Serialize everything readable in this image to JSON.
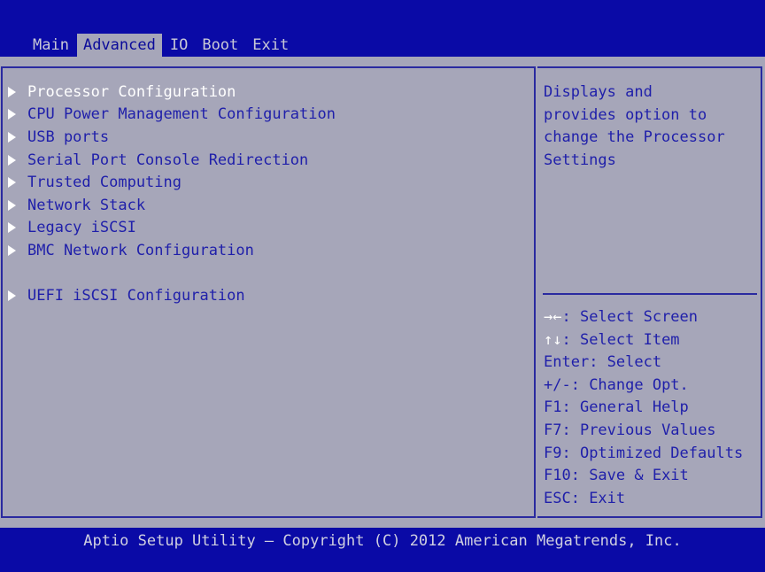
{
  "tabs": [
    {
      "label": "Main"
    },
    {
      "label": "Advanced"
    },
    {
      "label": "IO"
    },
    {
      "label": "Boot"
    },
    {
      "label": "Exit"
    }
  ],
  "menu": [
    {
      "label": "Processor Configuration"
    },
    {
      "label": "CPU Power Management Configuration"
    },
    {
      "label": "USB ports"
    },
    {
      "label": "Serial Port Console Redirection"
    },
    {
      "label": "Trusted Computing"
    },
    {
      "label": "Network Stack"
    },
    {
      "label": "Legacy iSCSI"
    },
    {
      "label": "BMC Network Configuration"
    },
    {
      "label": "UEFI iSCSI Configuration"
    }
  ],
  "help": {
    "lines": [
      "Displays and",
      "provides option to",
      "change the Processor",
      "Settings"
    ]
  },
  "keys": [
    {
      "key": "→←",
      "action": ": Select Screen"
    },
    {
      "key": "↑↓",
      "action": ": Select Item"
    },
    {
      "key": "Enter",
      "action": ": Select"
    },
    {
      "key": "+/-",
      "action": ": Change Opt."
    },
    {
      "key": "F1",
      "action": ": General Help"
    },
    {
      "key": "F7",
      "action": ": Previous Values"
    },
    {
      "key": "F9",
      "action": ": Optimized Defaults"
    },
    {
      "key": "F10",
      "action": ": Save & Exit"
    },
    {
      "key": "ESC",
      "action": ": Exit"
    }
  ],
  "footer": "Aptio Setup Utility – Copyright (C) 2012 American Megatrends, Inc.",
  "colors": {
    "background_blue": "#0000a8",
    "panel_grey": "#a6a6b9",
    "text_blue": "#1f1faa",
    "highlight_white": "#ffffff"
  }
}
